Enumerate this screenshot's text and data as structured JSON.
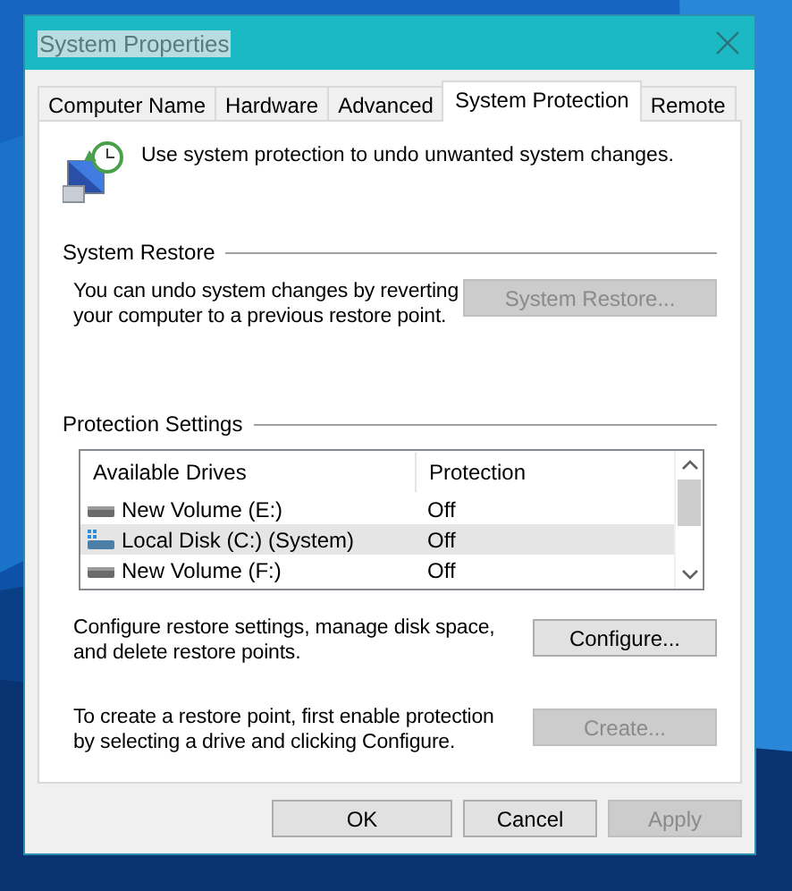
{
  "window": {
    "title": "System Properties",
    "title_highlighted": true
  },
  "tabs": [
    {
      "label": "Computer Name",
      "selected": false
    },
    {
      "label": "Hardware",
      "selected": false
    },
    {
      "label": "Advanced",
      "selected": false
    },
    {
      "label": "System Protection",
      "selected": true
    },
    {
      "label": "Remote",
      "selected": false
    }
  ],
  "intro": "Use system protection to undo unwanted system changes.",
  "system_restore": {
    "heading": "System Restore",
    "text": "You can undo system changes by reverting your computer to a previous restore point.",
    "button": {
      "label": "System Restore...",
      "disabled": true
    }
  },
  "protection_settings": {
    "heading": "Protection Settings",
    "columns": [
      "Available Drives",
      "Protection"
    ],
    "rows": [
      {
        "kind": "drive",
        "name": "New Volume (E:)",
        "protection": "Off",
        "selected": false
      },
      {
        "kind": "system-drive",
        "name": "Local Disk (C:) (System)",
        "protection": "Off",
        "selected": true
      },
      {
        "kind": "drive",
        "name": "New Volume (F:)",
        "protection": "Off",
        "selected": false
      }
    ],
    "configure": {
      "text": "Configure restore settings, manage disk space, and delete restore points.",
      "button": {
        "label": "Configure...",
        "disabled": false
      }
    },
    "create": {
      "text": "To create a restore point, first enable protection by selecting a drive and clicking Configure.",
      "button": {
        "label": "Create...",
        "disabled": true
      }
    }
  },
  "buttons": [
    {
      "label": "OK",
      "disabled": false
    },
    {
      "label": "Cancel",
      "disabled": false
    },
    {
      "label": "Apply",
      "disabled": true
    }
  ]
}
